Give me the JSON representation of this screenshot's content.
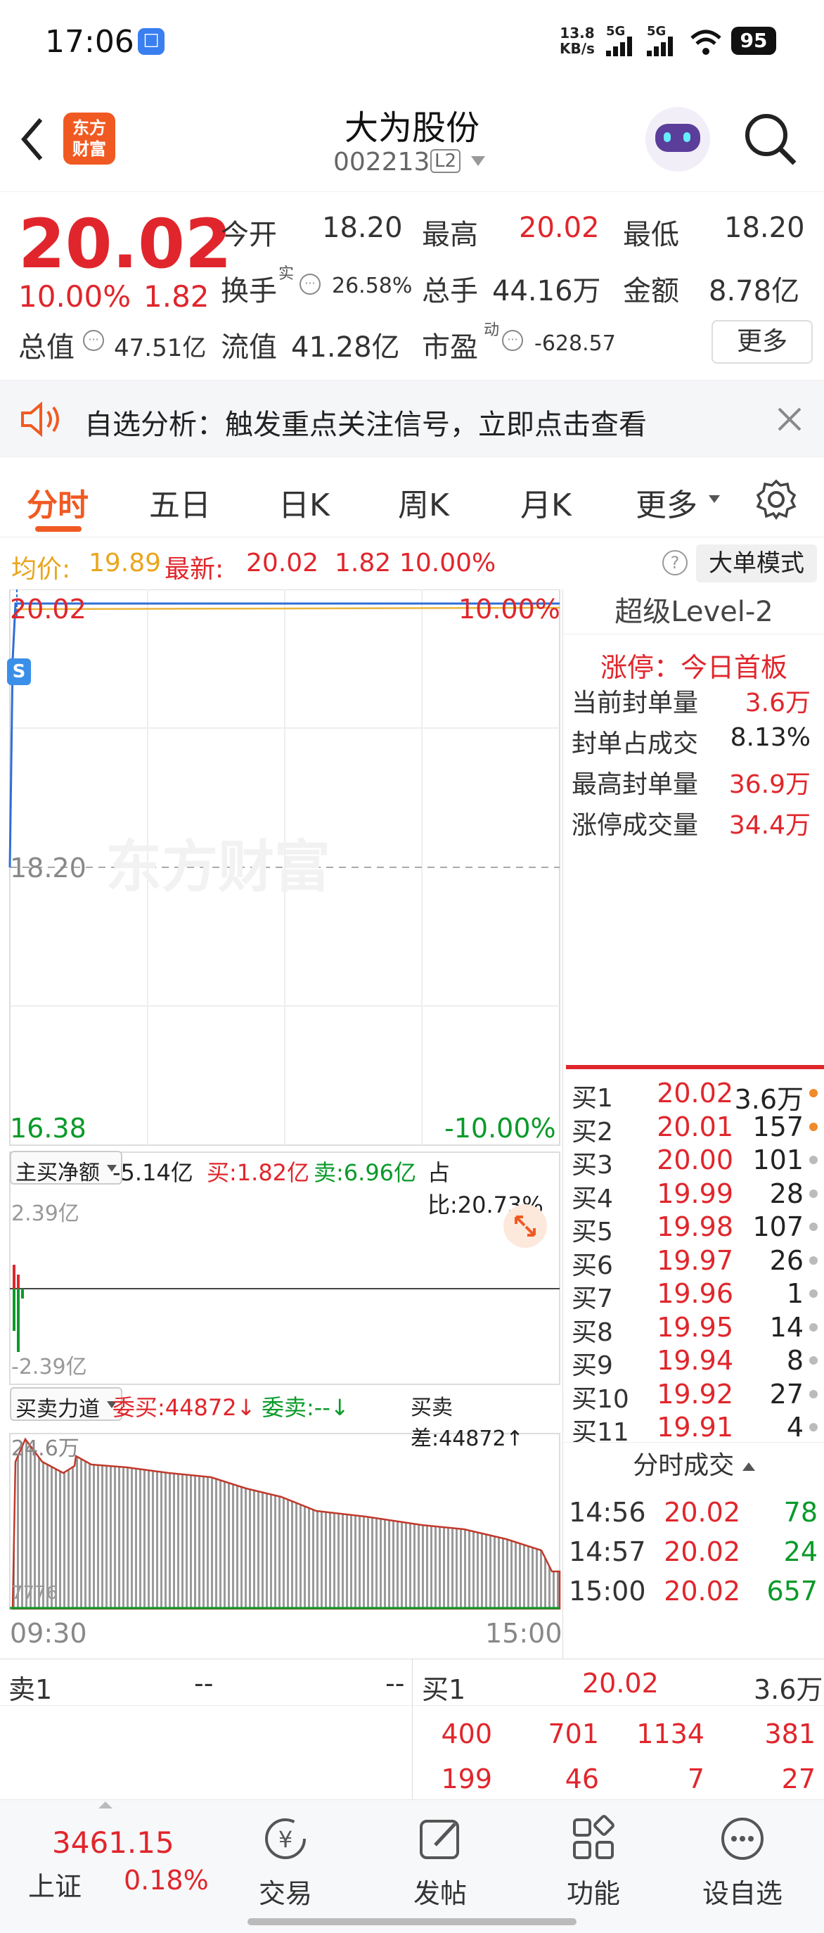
{
  "status_bar": {
    "time": "17:06",
    "net_speed_top": "13.8",
    "net_speed_bottom": "KB/s",
    "sig1": "5G",
    "sig2": "5G",
    "battery": "95"
  },
  "header": {
    "logo_text": "东方\n财富",
    "title": "大为股份",
    "code": "002213",
    "level_badge": "L2"
  },
  "quote": {
    "price": "20.02",
    "change_pct": "10.00%",
    "change": "1.82",
    "open_label": "今开",
    "open": "18.20",
    "high_label": "最高",
    "high": "20.02",
    "low_label": "最低",
    "low": "18.20",
    "turnover_label": "换手",
    "turnover_sup": "实",
    "turnover": "26.58%",
    "volume_label": "总手",
    "volume": "44.16万",
    "amount_label": "金额",
    "amount": "8.78亿",
    "mktcap_label": "总值",
    "mktcap": "47.51亿",
    "float_label": "流值",
    "float_cap": "41.28亿",
    "pe_label": "市盈",
    "pe_sup": "动",
    "pe": "-628.57",
    "more_button": "更多"
  },
  "banner": {
    "text": "自选分析：触发重点关注信号，立即点击查看"
  },
  "tabs": [
    "分时",
    "五日",
    "日K",
    "周K",
    "月K",
    "更多"
  ],
  "info_bar": {
    "avg_label": "均价:",
    "avg": "19.89",
    "latest_label": "最新:",
    "latest": "20.02",
    "change": "1.82",
    "pct": "10.00%",
    "big_order_button": "大单模式"
  },
  "chart": {
    "top_price": "20.02",
    "top_pct": "10.00%",
    "mid_price": "18.20",
    "low_price": "16.38",
    "low_pct": "-10.00%",
    "watermark": "东方财富",
    "s_marker": "S",
    "x_start": "09:30",
    "x_end": "15:00",
    "flow_select": "主买净额",
    "flow_net": "-5.14亿",
    "flow_buy": "买:1.82亿",
    "flow_sell": "卖:6.96亿",
    "flow_ratio": "占比:20.73%",
    "flow_top": "2.39亿",
    "flow_bottom": "-2.39亿",
    "power_select": "买卖力道",
    "power_bid": "委买:44872↓",
    "power_ask": "委卖:--↓",
    "power_diff": "买卖差:44872↑",
    "power_top": "24.6万",
    "power_bottom": "7776"
  },
  "level2": {
    "title": "超级Level-2",
    "limit_label": "涨停：今日首板",
    "stats": [
      {
        "label": "当前封单量",
        "value": "3.6万"
      },
      {
        "label": "封单占成交",
        "value": "8.13%"
      },
      {
        "label": "最高封单量",
        "value": "36.9万"
      },
      {
        "label": "涨停成交量",
        "value": "34.4万"
      }
    ],
    "bids": [
      {
        "n": "买1",
        "p": "20.02",
        "v": "3.6万",
        "c": "#f08a2a"
      },
      {
        "n": "买2",
        "p": "20.01",
        "v": "157",
        "c": "#f08a2a"
      },
      {
        "n": "买3",
        "p": "20.00",
        "v": "101",
        "c": "#bbbbbb"
      },
      {
        "n": "买4",
        "p": "19.99",
        "v": "28",
        "c": "#bbbbbb"
      },
      {
        "n": "买5",
        "p": "19.98",
        "v": "107",
        "c": "#bbbbbb"
      },
      {
        "n": "买6",
        "p": "19.97",
        "v": "26",
        "c": "#bbbbbb"
      },
      {
        "n": "买7",
        "p": "19.96",
        "v": "1",
        "c": "#bbbbbb"
      },
      {
        "n": "买8",
        "p": "19.95",
        "v": "14",
        "c": "#bbbbbb"
      },
      {
        "n": "买9",
        "p": "19.94",
        "v": "8",
        "c": "#bbbbbb"
      },
      {
        "n": "买10",
        "p": "19.92",
        "v": "27",
        "c": "#bbbbbb"
      },
      {
        "n": "买11",
        "p": "19.91",
        "v": "4",
        "c": "#bbbbbb"
      }
    ],
    "ticks_label": "分时成交",
    "ticks": [
      {
        "t": "14:56",
        "p": "20.02",
        "v": "78"
      },
      {
        "t": "14:57",
        "p": "20.02",
        "v": "24"
      },
      {
        "t": "15:00",
        "p": "20.02",
        "v": "657"
      }
    ]
  },
  "book": {
    "sell_label": "卖1",
    "sell_price": "--",
    "sell_vol": "--",
    "buy_label": "买1",
    "buy_price": "20.02",
    "buy_vol": "3.6万",
    "row1": [
      "400",
      "701",
      "1134",
      "381"
    ],
    "row2": [
      "199",
      "46",
      "7",
      "27"
    ]
  },
  "bottom": {
    "index_value": "3461.15",
    "index_name": "上证",
    "index_pct": "0.18%",
    "nav": [
      {
        "label": "交易",
        "icon": "trade-icon"
      },
      {
        "label": "发帖",
        "icon": "post-icon"
      },
      {
        "label": "功能",
        "icon": "apps-icon"
      },
      {
        "label": "设自选",
        "icon": "more-icon"
      }
    ]
  }
}
